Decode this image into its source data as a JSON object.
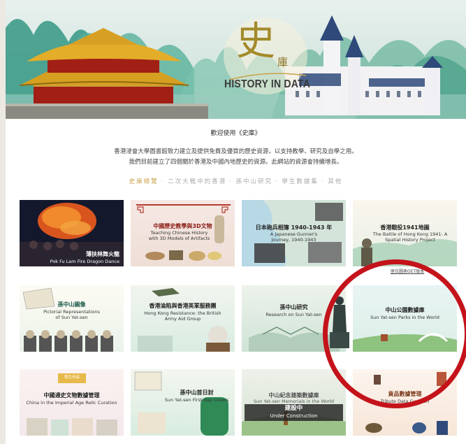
{
  "banner": {
    "logo_char": "史",
    "logo_sub": "庫",
    "logo_text": "HISTORY IN DATA"
  },
  "intro": {
    "welcome": "歡迎使用《史庫》",
    "line1": "香港浸會大學圖書館致力建立及提供免費及優質的歷史資源，以支持教學、研究及自學之用。",
    "line2": "我們目前建立了四個關於香港及中國內地歷史的資源。此網站的資源會持續增長。"
  },
  "nav": {
    "items": [
      "史庫總覽",
      "二次大戰中的香港",
      "孫中山研究",
      "學生數據集",
      "其他"
    ]
  },
  "cards": [
    {
      "title_zh": "薄扶林舞火龍",
      "title_en": "Pok Fu Lam Fire Dragon Dance"
    },
    {
      "title_zh": "中國歷史教學與3D文物",
      "title_en": "Teaching Chinese History with 3D Models of Artifacts"
    },
    {
      "title_zh": "日本砲兵相簿 1940-1943 年",
      "title_en": "A Japanese Gunner's Journey, 1940-1943"
    },
    {
      "title_zh": "香港戰役1941地圖",
      "title_en": "The Battle of Hong Kong 1941: A Spatial History Project"
    },
    {
      "title_zh": "孫中山圖像",
      "title_en": "Pictorial Representations of Sun Yat-sen"
    },
    {
      "title_zh": "香港淪陷與香港英軍服務團",
      "title_en": "Hong Kong Resistance: the British Army Aid Group"
    },
    {
      "title_zh": "孫中山研究",
      "title_en": "Research on Sun Yat-sen"
    },
    {
      "title_zh": "中山公園數據庫",
      "title_en": "Sun Yat-sen Parks in the World"
    },
    {
      "title_zh": "中國通史文物數據管理",
      "title_en": "China in the Imperial Age Relic Curation",
      "badge": "學生作品"
    },
    {
      "title_zh": "孫中山首日封",
      "title_en": "Sun Yat-sen First-day covers"
    },
    {
      "title_zh": "中山紀念建築數據庫",
      "title_en": "Sun Yat-sen Memorials in the World",
      "overlay_zh": "建設中",
      "overlay_en": "Under Construction"
    },
    {
      "title_zh": "貢品數據管理",
      "title_en": "Tribute Data Curation"
    }
  ],
  "small_link": "座位圖表GET版本",
  "colors": {
    "accent_gold": "#c9a24a",
    "highlight_ring": "#c4131b"
  }
}
